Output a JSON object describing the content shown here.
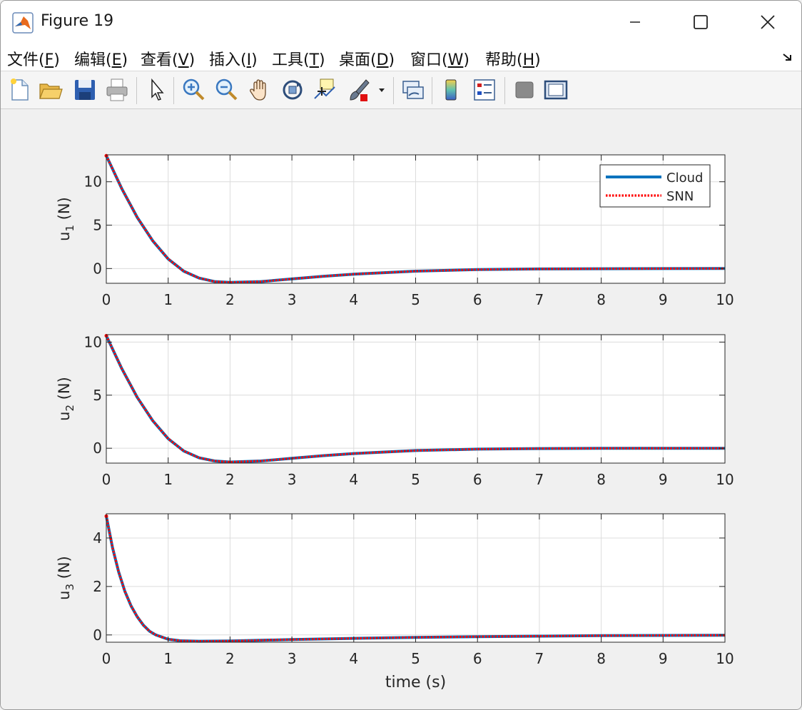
{
  "window": {
    "title": "Figure 19"
  },
  "menu": [
    {
      "label": "文件(",
      "key": "F",
      "end": ")"
    },
    {
      "label": "编辑(",
      "key": "E",
      "end": ")"
    },
    {
      "label": "查看(",
      "key": "V",
      "end": ")"
    },
    {
      "label": "插入(",
      "key": "I",
      "end": ")"
    },
    {
      "label": "工具(",
      "key": "T",
      "end": ")"
    },
    {
      "label": "桌面(",
      "key": "D",
      "end": ")"
    },
    {
      "label": "窗口(",
      "key": "W",
      "end": ")"
    },
    {
      "label": "帮助(",
      "key": "H",
      "end": ")"
    }
  ],
  "toolbar": {
    "icons": [
      "new-figure-icon",
      "open-folder-icon",
      "save-icon",
      "print-icon",
      "pointer-icon",
      "zoom-in-icon",
      "zoom-out-icon",
      "pan-hand-icon",
      "rotate-3d-icon",
      "data-cursor-icon",
      "brush-icon",
      "brush-dropdown-icon",
      "link-plot-icon",
      "colorbar-icon",
      "legend-icon",
      "hide-plot-tools-icon",
      "show-plot-tools-icon"
    ]
  },
  "colors": {
    "cloud": "#0072bd",
    "snn": "#ff0000",
    "grid": "#dcdcdc"
  },
  "chart_data": [
    {
      "type": "line",
      "xlabel": "",
      "ylabel_main": "u",
      "ylabel_sub": "1",
      "ylabel_unit": " (N)",
      "xlim": [
        0,
        10
      ],
      "ylim": [
        -1.7,
        13.1
      ],
      "xticks": [
        0,
        1,
        2,
        3,
        4,
        5,
        6,
        7,
        8,
        9,
        10
      ],
      "yticks": [
        0,
        5,
        10
      ],
      "grid": true,
      "legend": {
        "position": "top-right",
        "entries": [
          "Cloud",
          "SNN"
        ]
      },
      "series": [
        {
          "name": "Cloud",
          "x": [
            0,
            0.25,
            0.5,
            0.75,
            1,
            1.25,
            1.5,
            1.75,
            2,
            2.5,
            3,
            3.5,
            4,
            5,
            6,
            7,
            8,
            9,
            10
          ],
          "y": [
            13.0,
            9.2,
            5.9,
            3.2,
            1.1,
            -0.3,
            -1.1,
            -1.5,
            -1.6,
            -1.5,
            -1.2,
            -0.9,
            -0.65,
            -0.3,
            -0.12,
            -0.05,
            -0.02,
            -0.01,
            0.0
          ]
        },
        {
          "name": "SNN",
          "x": [
            0,
            0.25,
            0.5,
            0.75,
            1,
            1.25,
            1.5,
            1.75,
            2,
            2.5,
            3,
            3.5,
            4,
            5,
            6,
            7,
            8,
            9,
            10
          ],
          "y": [
            13.0,
            9.2,
            5.9,
            3.2,
            1.1,
            -0.3,
            -1.1,
            -1.5,
            -1.6,
            -1.5,
            -1.2,
            -0.9,
            -0.65,
            -0.3,
            -0.12,
            -0.05,
            -0.02,
            -0.01,
            0.0
          ]
        }
      ]
    },
    {
      "type": "line",
      "xlabel": "",
      "ylabel_main": "u",
      "ylabel_sub": "2",
      "ylabel_unit": " (N)",
      "xlim": [
        0,
        10
      ],
      "ylim": [
        -1.4,
        10.7
      ],
      "xticks": [
        0,
        1,
        2,
        3,
        4,
        5,
        6,
        7,
        8,
        9,
        10
      ],
      "yticks": [
        0,
        5,
        10
      ],
      "grid": true,
      "series": [
        {
          "name": "Cloud",
          "x": [
            0,
            0.25,
            0.5,
            0.75,
            1,
            1.25,
            1.5,
            1.75,
            2,
            2.5,
            3,
            3.5,
            4,
            5,
            6,
            7,
            8,
            9,
            10
          ],
          "y": [
            10.6,
            7.5,
            4.8,
            2.6,
            0.9,
            -0.25,
            -0.9,
            -1.2,
            -1.3,
            -1.2,
            -0.95,
            -0.7,
            -0.5,
            -0.22,
            -0.08,
            -0.03,
            -0.01,
            0.0,
            0.0
          ]
        },
        {
          "name": "SNN",
          "x": [
            0,
            0.25,
            0.5,
            0.75,
            1,
            1.25,
            1.5,
            1.75,
            2,
            2.5,
            3,
            3.5,
            4,
            5,
            6,
            7,
            8,
            9,
            10
          ],
          "y": [
            10.6,
            7.5,
            4.8,
            2.6,
            0.9,
            -0.25,
            -0.9,
            -1.2,
            -1.3,
            -1.2,
            -0.95,
            -0.7,
            -0.5,
            -0.22,
            -0.08,
            -0.03,
            -0.01,
            0.0,
            0.0
          ]
        }
      ]
    },
    {
      "type": "line",
      "xlabel": "time (s)",
      "ylabel_main": "u",
      "ylabel_sub": "3",
      "ylabel_unit": " (N)",
      "xlim": [
        0,
        10
      ],
      "ylim": [
        -0.3,
        5.0
      ],
      "xticks": [
        0,
        1,
        2,
        3,
        4,
        5,
        6,
        7,
        8,
        9,
        10
      ],
      "yticks": [
        0,
        2,
        4
      ],
      "grid": true,
      "series": [
        {
          "name": "Cloud",
          "x": [
            0,
            0.1,
            0.2,
            0.3,
            0.4,
            0.5,
            0.6,
            0.7,
            0.8,
            1,
            1.2,
            1.5,
            2,
            2.5,
            3,
            4,
            5,
            6,
            7,
            8,
            9,
            10
          ],
          "y": [
            4.9,
            3.6,
            2.6,
            1.8,
            1.2,
            0.75,
            0.4,
            0.15,
            0.0,
            -0.18,
            -0.24,
            -0.26,
            -0.25,
            -0.22,
            -0.19,
            -0.14,
            -0.1,
            -0.07,
            -0.05,
            -0.03,
            -0.02,
            -0.01
          ]
        },
        {
          "name": "SNN",
          "x": [
            0,
            0.1,
            0.2,
            0.3,
            0.4,
            0.5,
            0.6,
            0.7,
            0.8,
            1,
            1.2,
            1.5,
            2,
            2.5,
            3,
            4,
            5,
            6,
            7,
            8,
            9,
            10
          ],
          "y": [
            4.9,
            3.6,
            2.6,
            1.8,
            1.2,
            0.75,
            0.4,
            0.15,
            0.0,
            -0.18,
            -0.24,
            -0.26,
            -0.25,
            -0.22,
            -0.19,
            -0.14,
            -0.1,
            -0.07,
            -0.05,
            -0.03,
            -0.02,
            -0.01
          ]
        }
      ]
    }
  ]
}
